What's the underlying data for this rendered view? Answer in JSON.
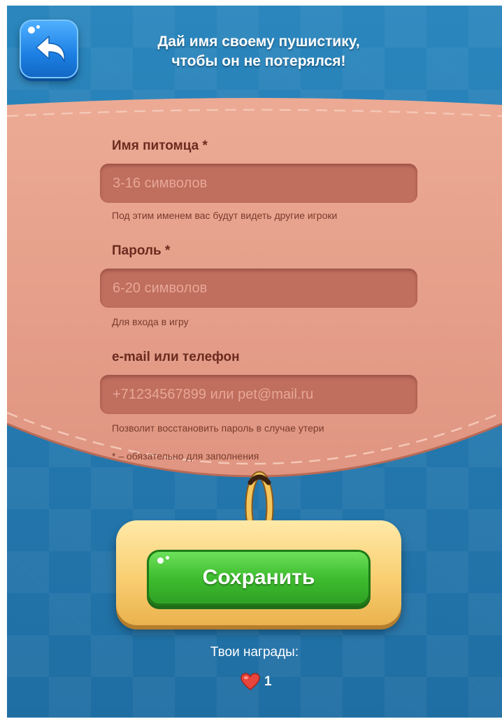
{
  "header": {
    "title_line1": "Дай имя своему пушистику,",
    "title_line2": "чтобы он не потерялся!",
    "back_icon": "back-arrow-icon"
  },
  "form": {
    "pet_name": {
      "label": "Имя питомца *",
      "placeholder": "3-16 символов",
      "value": "",
      "hint": "Под этим именем вас будут видеть другие игроки"
    },
    "password": {
      "label": "Пароль *",
      "placeholder": "6-20 символов",
      "value": "",
      "hint": "Для входа в игру"
    },
    "contact": {
      "label": "e-mail или телефон",
      "placeholder": "+71234567899 или pet@mail.ru",
      "value": "",
      "hint": "Позволит восстановить пароль в случае утери"
    },
    "required_note": "* – обязательно для заполнения"
  },
  "save_button": {
    "label": "Сохранить"
  },
  "rewards": {
    "title": "Твои награды:",
    "icon": "heart-icon",
    "count": "1"
  },
  "colors": {
    "background": "#2377ad",
    "panel": "#e49b87",
    "input": "#c06e5e",
    "label": "#6b2b1f",
    "button_green": "#3fbd2f",
    "tag_gold": "#f9cf72",
    "back_button": "#1c7fe3"
  }
}
